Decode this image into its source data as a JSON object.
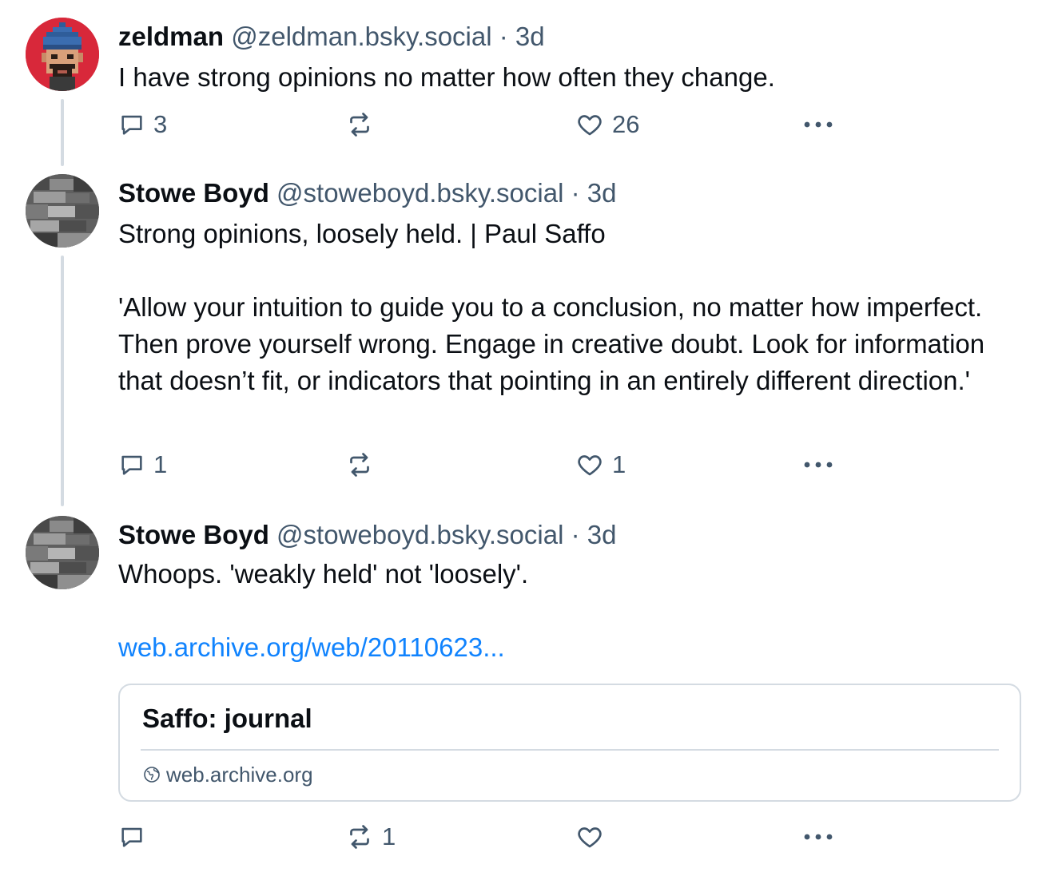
{
  "posts": [
    {
      "author": "zeldman",
      "handle": "@zeldman.bsky.social",
      "separator": "·",
      "time": "3d",
      "avatar_icon": "pixel-avatar-bearded-man-blue-beanie",
      "text": [
        "I have strong opinions no matter how often they change."
      ],
      "actions": {
        "reply_count": "3",
        "repost_count": "",
        "like_count": "26"
      }
    },
    {
      "author": "Stowe Boyd",
      "handle": "@stoweboyd.bsky.social",
      "separator": "·",
      "time": "3d",
      "avatar_icon": "grayscale-abstract-avatar",
      "text": [
        "Strong opinions, loosely held. | Paul Saffo",
        "'Allow your intuition to guide you to a conclusion, no matter how imperfect. Then prove yourself wrong. Engage in creative doubt. Look for information that doesn’t fit, or indicators that pointing in an entirely different direction.'"
      ],
      "actions": {
        "reply_count": "1",
        "repost_count": "",
        "like_count": "1"
      }
    },
    {
      "author": "Stowe Boyd",
      "handle": "@stoweboyd.bsky.social",
      "separator": "·",
      "time": "3d",
      "avatar_icon": "grayscale-abstract-avatar",
      "text": [
        "Whoops. 'weakly held' not 'loosely'."
      ],
      "link": "web.archive.org/web/20110623...",
      "card": {
        "title": "Saffo: journal",
        "domain": "web.archive.org"
      },
      "actions": {
        "reply_count": "",
        "repost_count": "1",
        "like_count": ""
      }
    }
  ],
  "icons": {
    "reply": "reply-icon",
    "repost": "repost-icon",
    "like": "heart-icon",
    "more": "more-options-icon",
    "globe": "globe-icon"
  },
  "colors": {
    "text": "#0b0f14",
    "muted": "#42576c",
    "link": "#1083fe",
    "border": "#d4dbe2",
    "zeldman_avatar_bg": "#d8283a"
  }
}
